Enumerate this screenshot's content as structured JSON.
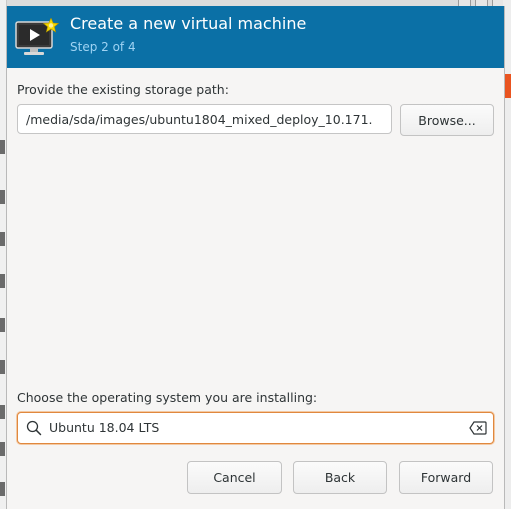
{
  "dialog": {
    "title": "Create a new virtual machine",
    "step": "Step 2 of 4",
    "icon": "virtual-machine-icon"
  },
  "storage": {
    "label": "Provide the existing storage path:",
    "path_value": "/media/sda/images/ubuntu1804_mixed_deploy_10.171.",
    "browse_label": "Browse..."
  },
  "os": {
    "label": "Choose the operating system you are installing:",
    "search_value": "Ubuntu 18.04 LTS",
    "search_icon": "search-icon",
    "clear_icon": "clear-icon"
  },
  "buttons": {
    "cancel": "Cancel",
    "back": "Back",
    "forward": "Forward"
  },
  "colors": {
    "header_bg": "#0b70a6",
    "step_text": "#9fd3f3",
    "focus_border": "#e0883e"
  }
}
